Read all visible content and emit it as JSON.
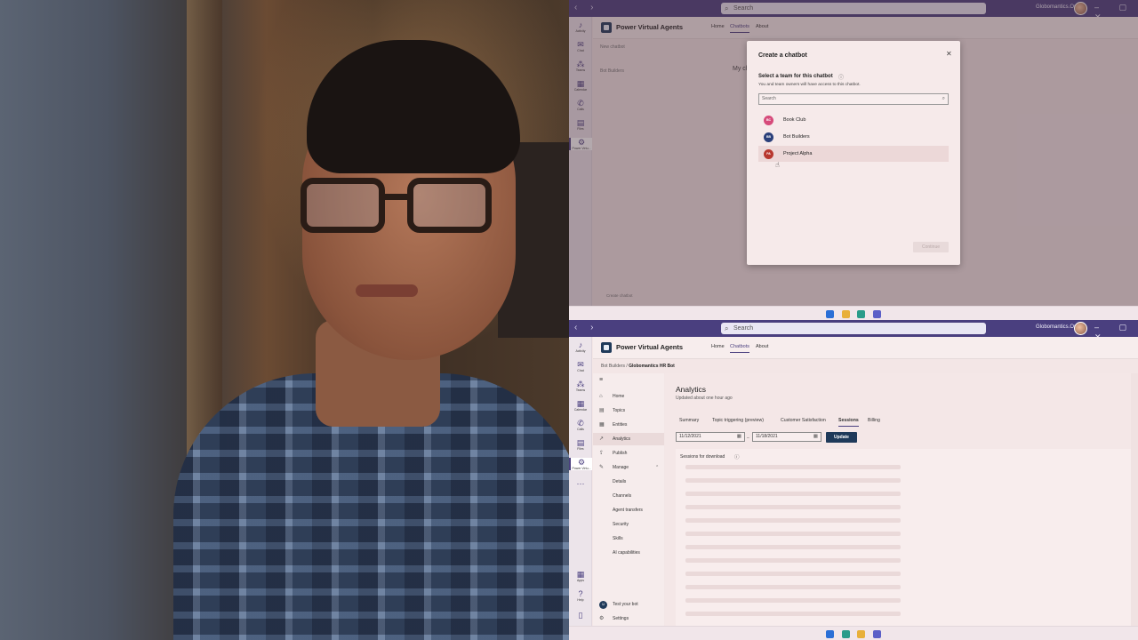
{
  "teams_window": {
    "search_placeholder": "Search",
    "org_name": "Globomantics.Org",
    "app_name": "Power Virtual Agents",
    "tabs": [
      "Home",
      "Chatbots",
      "About"
    ],
    "rail": [
      "Activity",
      "Chat",
      "Teams",
      "Calendar",
      "Calls",
      "Files",
      "Power Virtu..."
    ],
    "rail_bottom": [
      "Apps",
      "Help"
    ]
  },
  "top_screen": {
    "behind_nav": [
      "New chatbot",
      "Bot Builders"
    ],
    "behind_heading": "My chatbots",
    "behind_footer": "Create chatbot",
    "dialog": {
      "title": "Create a chatbot",
      "close": "✕",
      "label": "Select a team for this chatbot",
      "info_icon": "ⓘ",
      "help": "You and team owners will have access to this chatbot.",
      "search_placeholder": "Search",
      "teams": [
        {
          "initials": "BC",
          "name": "Book Club",
          "color": "#d64a7a"
        },
        {
          "initials": "BB",
          "name": "Bot Builders",
          "color": "#2a3f7a"
        },
        {
          "initials": "PA",
          "name": "Project Alpha",
          "color": "#b8382f"
        }
      ],
      "selected_index": 2,
      "continue_label": "Continue"
    }
  },
  "bottom_screen": {
    "breadcrumb_team": "Bot Builders",
    "breadcrumb_sep": "/",
    "breadcrumb_bot": "Globomantics HR Bot",
    "nav": {
      "home": "Home",
      "topics": "Topics",
      "entities": "Entities",
      "analytics": "Analytics",
      "publish": "Publish",
      "manage": "Manage",
      "details": "Details",
      "channels": "Channels",
      "agent_transfers": "Agent transfers",
      "security": "Security",
      "skills": "Skills",
      "ai_capabilities": "AI capabilities",
      "test_bot": "Test your bot",
      "settings": "Settings"
    },
    "main": {
      "title": "Analytics",
      "updated": "Updated about one hour ago",
      "tabs": [
        "Summary",
        "Topic triggering (preview)",
        "Customer Satisfaction",
        "Sessions",
        "Billing"
      ],
      "active_tab": "Sessions",
      "date_from": "11/12/2021",
      "date_to": "11/18/2021",
      "date_sep": "–",
      "update_label": "Update",
      "panel_title": "Sessions for download",
      "panel_info": "ⓘ"
    }
  },
  "colors": {
    "teams_purple": "#4a3f7f",
    "pva_navy": "#1f3a5a",
    "tint": "#f3e6e6"
  }
}
